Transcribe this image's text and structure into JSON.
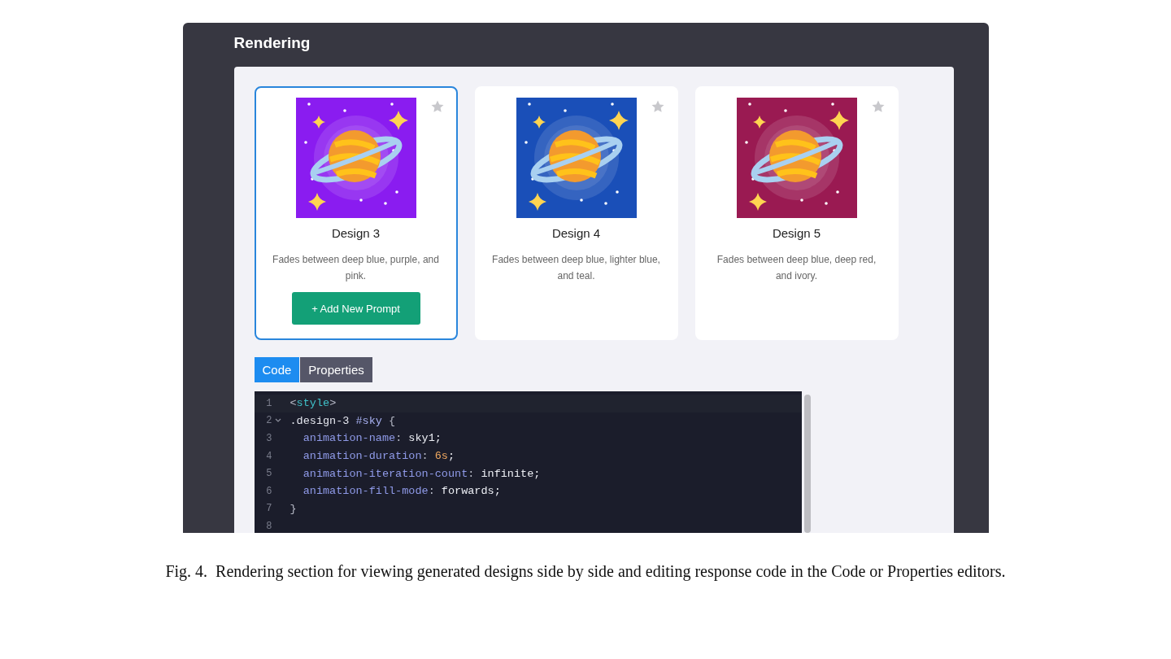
{
  "section": {
    "title": "Rendering"
  },
  "designs": [
    {
      "title": "Design 3",
      "description": "Fades between deep blue, purple, and pink.",
      "selected": true,
      "starred": false,
      "color": "#8a1cf0",
      "button": "+ Add New Prompt"
    },
    {
      "title": "Design 4",
      "description": "Fades between deep blue, lighter blue, and teal.",
      "selected": false,
      "starred": false,
      "color": "#1a4fb8"
    },
    {
      "title": "Design 5",
      "description": "Fades between deep blue, deep red, and ivory.",
      "selected": false,
      "starred": false,
      "color": "#9a1a52"
    }
  ],
  "tabs": [
    {
      "label": "Code",
      "selected": true
    },
    {
      "label": "Properties",
      "selected": false
    }
  ],
  "code_lines": [
    {
      "number": "1",
      "foldable": false,
      "tokens": [
        {
          "text": "<",
          "kind": "punct"
        },
        {
          "text": "style",
          "kind": "tag"
        },
        {
          "text": ">",
          "kind": "punct"
        }
      ]
    },
    {
      "number": "2",
      "foldable": true,
      "tokens": [
        {
          "text": ".design-3 ",
          "kind": "selector"
        },
        {
          "text": "#sky",
          "kind": "id"
        },
        {
          "text": " {",
          "kind": "punct"
        }
      ]
    },
    {
      "number": "3",
      "foldable": false,
      "tokens": [
        {
          "text": "  animation-name",
          "kind": "property"
        },
        {
          "text": ": ",
          "kind": "punct"
        },
        {
          "text": "sky1;",
          "kind": "value"
        }
      ]
    },
    {
      "number": "4",
      "foldable": false,
      "tokens": [
        {
          "text": "  animation-duration",
          "kind": "property"
        },
        {
          "text": ": ",
          "kind": "punct"
        },
        {
          "text": "6s",
          "kind": "number"
        },
        {
          "text": ";",
          "kind": "value"
        }
      ]
    },
    {
      "number": "5",
      "foldable": false,
      "tokens": [
        {
          "text": "  animation-iteration-count",
          "kind": "property"
        },
        {
          "text": ": ",
          "kind": "punct"
        },
        {
          "text": "infinite;",
          "kind": "value"
        }
      ]
    },
    {
      "number": "6",
      "foldable": false,
      "tokens": [
        {
          "text": "  animation-fill-mode",
          "kind": "property"
        },
        {
          "text": ": ",
          "kind": "punct"
        },
        {
          "text": "forwards;",
          "kind": "value"
        }
      ]
    },
    {
      "number": "7",
      "foldable": false,
      "tokens": [
        {
          "text": "}",
          "kind": "punct"
        }
      ]
    },
    {
      "number": "8",
      "foldable": false
    }
  ],
  "caption": "Fig. 4.  Rendering section for viewing generated designs side by side and editing response code in the Code or Properties editors."
}
